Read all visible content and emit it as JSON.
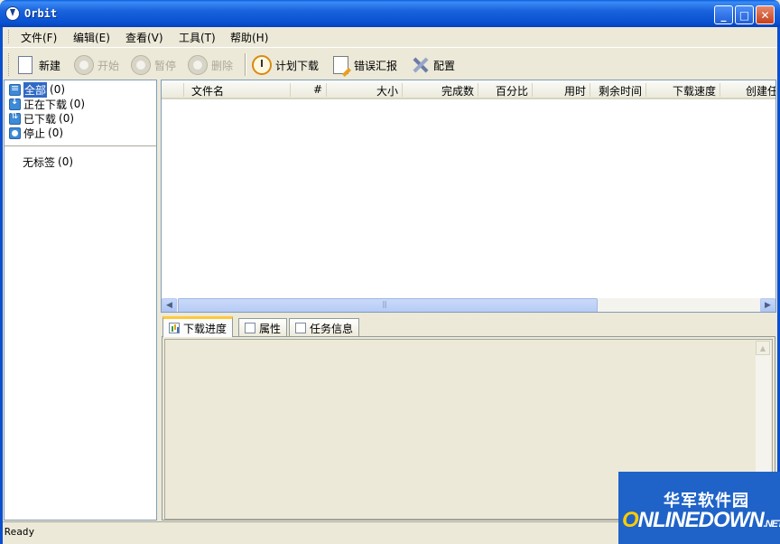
{
  "window": {
    "title": "Orbit"
  },
  "menu": [
    {
      "label": "文件(F)"
    },
    {
      "label": "编辑(E)"
    },
    {
      "label": "查看(V)"
    },
    {
      "label": "工具(T)"
    },
    {
      "label": "帮助(H)"
    }
  ],
  "toolbar": {
    "new_label": "新建",
    "start_label": "开始",
    "pause_label": "暂停",
    "delete_label": "删除",
    "schedule_label": "计划下载",
    "error_label": "错误汇报",
    "config_label": "配置"
  },
  "tree": {
    "items": [
      {
        "label": "全部",
        "count": "(0)"
      },
      {
        "label": "正在下载",
        "count": "(0)"
      },
      {
        "label": "已下载",
        "count": "(0)"
      },
      {
        "label": "停止",
        "count": "(0)"
      }
    ],
    "tag": {
      "label": "无标签",
      "count": "(0)"
    }
  },
  "list": {
    "columns": [
      "文件名",
      "#",
      "大小",
      "完成数",
      "百分比",
      "用时",
      "剩余时间",
      "下载速度",
      "创建任"
    ]
  },
  "tabs": [
    {
      "label": "下载进度"
    },
    {
      "label": "属性"
    },
    {
      "label": "任务信息"
    }
  ],
  "status": {
    "text": "Ready"
  },
  "watermark": {
    "top": "华军软件园",
    "logo_o": "O",
    "logo_rest": "NLINEDOWN",
    "logo_net": ".NET"
  },
  "colors": {
    "titlebar": "#0a5fe0",
    "selection": "#316ac5",
    "tab_accent": "#ffc83c"
  }
}
